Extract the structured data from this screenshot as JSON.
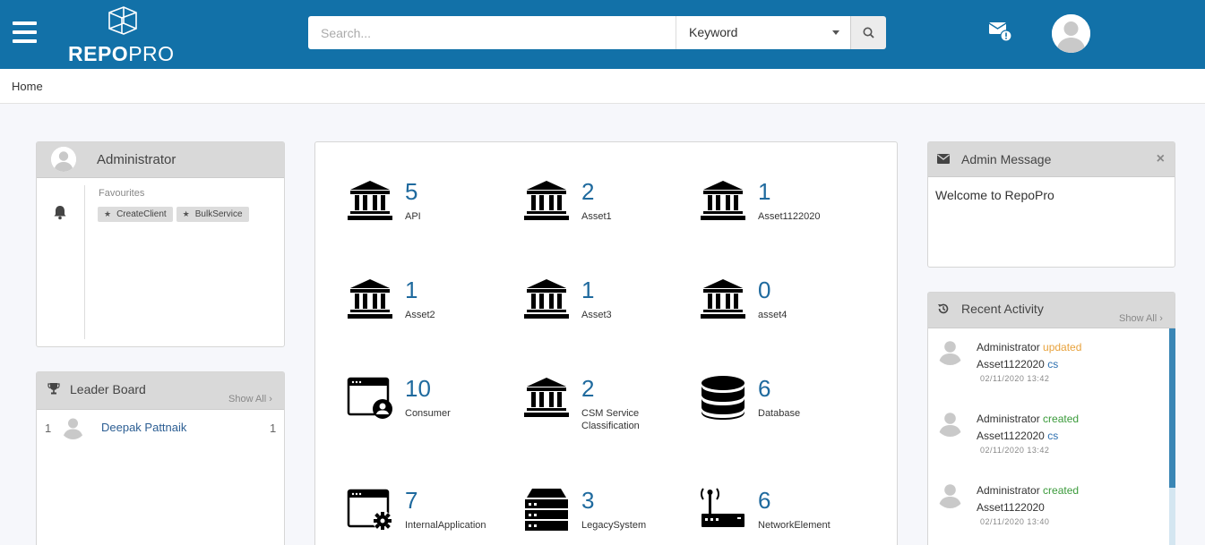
{
  "header": {
    "logo_text_bold": "REPO",
    "logo_text_light": "PRO",
    "search": {
      "placeholder": "Search...",
      "mode": "Keyword"
    }
  },
  "breadcrumb": {
    "label": "Home"
  },
  "user_panel": {
    "name": "Administrator",
    "favourites_label": "Favourites",
    "favourites": [
      "CreateClient",
      "BulkService"
    ]
  },
  "leader_board": {
    "title": "Leader Board",
    "show_all": "Show All",
    "entries": [
      {
        "rank": "1",
        "name": "Deepak Pattnaik",
        "score": "1"
      }
    ]
  },
  "asset_tiles": [
    {
      "count": "5",
      "label": "API",
      "icon": "bank-icon"
    },
    {
      "count": "2",
      "label": "Asset1",
      "icon": "bank-icon"
    },
    {
      "count": "1",
      "label": "Asset1122020",
      "icon": "bank-icon"
    },
    {
      "count": "1",
      "label": "Asset2",
      "icon": "bank-icon"
    },
    {
      "count": "1",
      "label": "Asset3",
      "icon": "bank-icon"
    },
    {
      "count": "0",
      "label": "asset4",
      "icon": "bank-icon"
    },
    {
      "count": "10",
      "label": "Consumer",
      "icon": "browser-user-icon"
    },
    {
      "count": "2",
      "label": "CSM Service Classification",
      "icon": "bank-icon"
    },
    {
      "count": "6",
      "label": "Database",
      "icon": "database-icon"
    },
    {
      "count": "7",
      "label": "InternalApplication",
      "icon": "browser-gear-icon"
    },
    {
      "count": "3",
      "label": "LegacySystem",
      "icon": "server-icon"
    },
    {
      "count": "6",
      "label": "NetworkElement",
      "icon": "router-icon"
    }
  ],
  "admin_message": {
    "title": "Admin Message",
    "close": "×",
    "body": "Welcome to RepoPro"
  },
  "recent_activity": {
    "title": "Recent Activity",
    "show_all": "Show All",
    "items": [
      {
        "user": "Administrator",
        "action": "updated",
        "target": "Asset1122020",
        "extra": "cs",
        "time": "02/11/2020 13:42"
      },
      {
        "user": "Administrator",
        "action": "created",
        "target": "Asset1122020",
        "extra": "cs",
        "time": "02/11/2020 13:42"
      },
      {
        "user": "Administrator",
        "action": "created",
        "target": "Asset1122020",
        "extra": "",
        "time": "02/11/2020 13:40"
      }
    ]
  },
  "colors": {
    "header_bg": "#1271a8",
    "count_blue": "#1f6a9e",
    "updated": "#e8a23c",
    "created": "#3a9a3a"
  }
}
